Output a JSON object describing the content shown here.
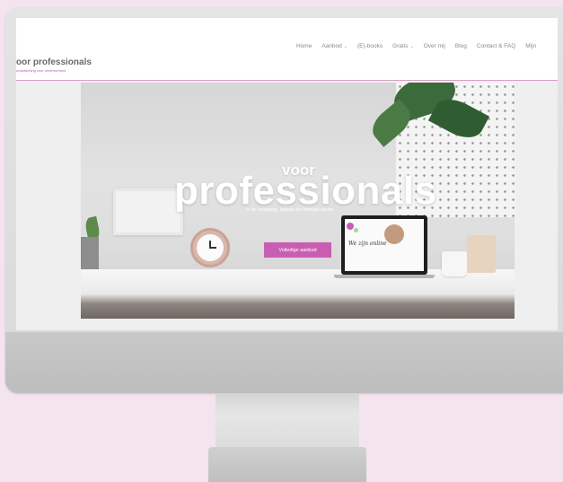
{
  "site": {
    "logo_title": "oor professionals",
    "logo_tagline": "ontwikkeling voor ondernemers"
  },
  "nav": {
    "items": [
      {
        "label": "Home",
        "has_dropdown": false
      },
      {
        "label": "Aanbod",
        "has_dropdown": true
      },
      {
        "label": "(E)-books",
        "has_dropdown": false
      },
      {
        "label": "Gratis",
        "has_dropdown": true
      },
      {
        "label": "Over mij",
        "has_dropdown": false
      },
      {
        "label": "Blog",
        "has_dropdown": false
      },
      {
        "label": "Contact & FAQ",
        "has_dropdown": false
      },
      {
        "label": "Mijn",
        "has_dropdown": false
      }
    ]
  },
  "hero": {
    "voor": "voor",
    "title": "professionals",
    "subtitle": "in de huidzorg, beauty en lifestyle sector",
    "cta_label": "Volledige aanbod",
    "laptop_text": "We zijn online"
  },
  "colors": {
    "brand_pink": "#c85eb2",
    "background": "#f3e4ee"
  }
}
